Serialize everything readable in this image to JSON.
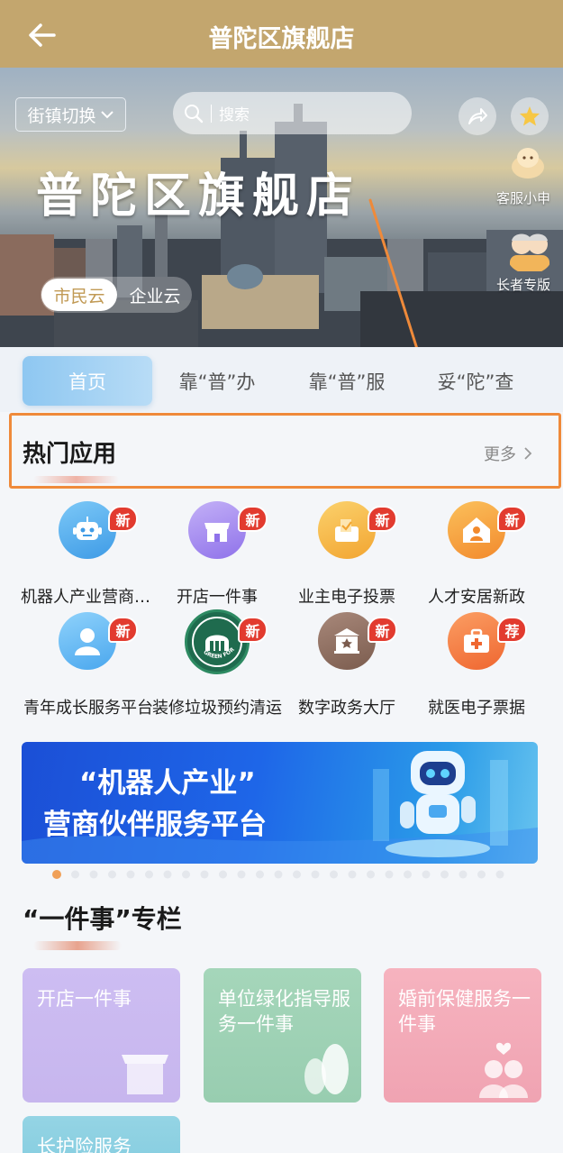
{
  "header": {
    "title": "普陀区旗舰店"
  },
  "hero": {
    "town_switch_label": "街镇切换",
    "search_placeholder": "搜索",
    "headline": "普陀区旗舰店",
    "customer_service_label": "客服小申",
    "elder_mode_label": "长者专版",
    "switch_options": [
      "市民云",
      "企业云"
    ],
    "switch_selected": "市民云"
  },
  "tabs": [
    {
      "label": "首页",
      "active": true
    },
    {
      "label": "靠“普”办",
      "active": false
    },
    {
      "label": "靠“普”服",
      "active": false
    },
    {
      "label": "妥“陀”查",
      "active": false
    }
  ],
  "hot_apps": {
    "title": "热门应用",
    "more_label": "更多",
    "apps": [
      {
        "label": "机器人产业营商伙伴服务平台",
        "badge": "新",
        "icon": "robot-icon",
        "color": "#59b4f1"
      },
      {
        "label": "开店一件事",
        "badge": "新",
        "icon": "shop-icon",
        "color": "#a88bf0"
      },
      {
        "label": "业主电子投票",
        "badge": "新",
        "icon": "ballot-icon",
        "color": "#f5b83d"
      },
      {
        "label": "人才安居新政",
        "badge": "新",
        "icon": "house-person-icon",
        "color": "#f39a3a"
      },
      {
        "label": "青年成长服务平台",
        "badge": "新",
        "icon": "person-icon",
        "color": "#5ab0ee"
      },
      {
        "label": "装修垃圾预约清运",
        "badge": "新",
        "icon": "green-fortune-logo",
        "color": "#1f6b4e"
      },
      {
        "label": "数字政务大厅",
        "badge": "新",
        "icon": "government-hall-icon",
        "color": "#8b6a58"
      },
      {
        "label": "就医电子票据",
        "badge": "荐",
        "icon": "medical-kit-icon",
        "color": "#f2773d"
      }
    ],
    "logo_text": "GREEN FORTUNE"
  },
  "banner": {
    "line1": "“机器人产业”",
    "line2": "营商伙伴服务平台",
    "page_count": 25,
    "current_page": 1
  },
  "special_section": {
    "title": "“一件事”专栏",
    "cards": [
      {
        "label": "开店一件事",
        "color": "#c6b4ee"
      },
      {
        "label": "单位绿化指导服务一件事",
        "color": "#9ccfb2"
      },
      {
        "label": "婚前保健服务一件事",
        "color": "#f3a9b6"
      },
      {
        "label": "长护险服务",
        "color": "#8ccfe0"
      }
    ]
  },
  "colors": {
    "header_bg": "#c3a66e",
    "tab_active": "#8ec7f1",
    "annotation_orange": "#ef8a3a",
    "badge_red": "#e23b2f"
  }
}
